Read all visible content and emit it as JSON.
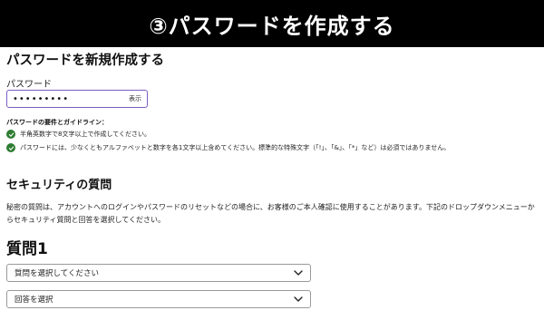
{
  "banner": {
    "title": "③パスワードを作成する"
  },
  "form": {
    "title": "パスワードを新規作成する",
    "password_label": "パスワード",
    "password_value": "•••••••••",
    "show_label": "表示",
    "requirements_heading": "パスワードの要件とガイドライン：",
    "requirements": [
      "半角英数字で8文字以上で作成してください。",
      "パスワードには、少なくともアルファベットと数字を各1文字以上含めてください。標準的な特殊文字（「!」、「&」、「*」など）は必須ではありません。"
    ]
  },
  "security": {
    "title": "セキュリティの質問",
    "description": "秘密の質問は、アカウントへのログインやパスワードのリセットなどの場合に、お客様のご本人確認に使用することがあります。下記のドロップダウンメニューからセキュリティ質問と回答を選択してください。",
    "question_title": "質問1",
    "question_select": "質問を選択してください",
    "answer_select": "回答を選択"
  },
  "colors": {
    "check": "#2e7d32",
    "field_border": "#7b5cc4",
    "banner_bg": "#000000"
  }
}
